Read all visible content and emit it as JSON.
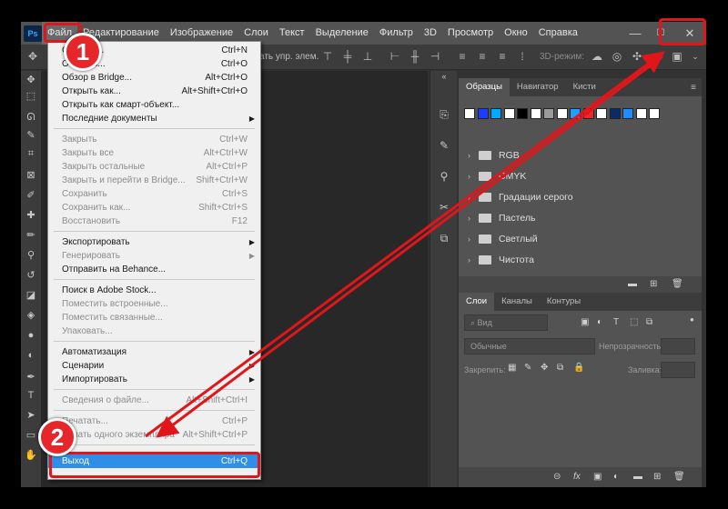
{
  "app": {
    "logo": "Ps"
  },
  "menubar": [
    "Файл",
    "Редактирование",
    "Изображение",
    "Слои",
    "Текст",
    "Выделение",
    "Фильтр",
    "3D",
    "Просмотр",
    "Окно",
    "Справка"
  ],
  "window_controls": {
    "minimize": "—",
    "maximize": "☐",
    "close": "✕"
  },
  "options_bar": {
    "text": "ать упр. элем.",
    "mode3d": "3D-режим:"
  },
  "file_menu": {
    "items": [
      {
        "label": "Создать...",
        "shortcut": "Ctrl+N"
      },
      {
        "label": "Открыть...",
        "shortcut": "Ctrl+O"
      },
      {
        "label": "Обзор в Bridge...",
        "shortcut": "Alt+Ctrl+O"
      },
      {
        "label": "Открыть как...",
        "shortcut": "Alt+Shift+Ctrl+O"
      },
      {
        "label": "Открыть как смарт-объект...",
        "shortcut": ""
      },
      {
        "label": "Последние документы",
        "shortcut": "",
        "submenu": true
      },
      {
        "label": "Закрыть",
        "shortcut": "Ctrl+W",
        "disabled": true
      },
      {
        "label": "Закрыть все",
        "shortcut": "Alt+Ctrl+W",
        "disabled": true
      },
      {
        "label": "Закрыть остальные",
        "shortcut": "Alt+Ctrl+P",
        "disabled": true
      },
      {
        "label": "Закрыть и перейти в Bridge...",
        "shortcut": "Shift+Ctrl+W",
        "disabled": true
      },
      {
        "label": "Сохранить",
        "shortcut": "Ctrl+S",
        "disabled": true
      },
      {
        "label": "Сохранить как...",
        "shortcut": "Shift+Ctrl+S",
        "disabled": true
      },
      {
        "label": "Восстановить",
        "shortcut": "F12",
        "disabled": true
      },
      {
        "label": "Экспортировать",
        "shortcut": "",
        "submenu": true
      },
      {
        "label": "Генерировать",
        "shortcut": "",
        "submenu": true,
        "disabled": true
      },
      {
        "label": "Отправить на Behance...",
        "shortcut": ""
      },
      {
        "label": "Поиск в Adobe Stock...",
        "shortcut": ""
      },
      {
        "label": "Поместить встроенные...",
        "shortcut": "",
        "disabled": true
      },
      {
        "label": "Поместить связанные...",
        "shortcut": "",
        "disabled": true
      },
      {
        "label": "Упаковать...",
        "shortcut": "",
        "disabled": true
      },
      {
        "label": "Автоматизация",
        "shortcut": "",
        "submenu": true
      },
      {
        "label": "Сценарии",
        "shortcut": "",
        "submenu": true
      },
      {
        "label": "Импортировать",
        "shortcut": "",
        "submenu": true
      },
      {
        "label": "Сведения о файле...",
        "shortcut": "Alt+Shift+Ctrl+I",
        "disabled": true
      },
      {
        "label": "Печатать...",
        "shortcut": "Ctrl+P",
        "disabled": true
      },
      {
        "label": "Печать одного экземпляра",
        "shortcut": "Alt+Shift+Ctrl+P",
        "disabled": true
      },
      {
        "label": "Выход",
        "shortcut": "Ctrl+Q",
        "highlighted": true
      }
    ]
  },
  "swatches_panel": {
    "tabs": [
      "Образцы",
      "Навигатор",
      "Кисти"
    ],
    "colors": [
      "#ffffff",
      "#1e3cff",
      "#00a8ff",
      "#ffffff",
      "#000000",
      "#ffffff",
      "#9a9a9a",
      "#ffffff",
      "#1aa0ff",
      "#e52b2b",
      "#ffffff",
      "#0a2a6a",
      "#1e8cff",
      "#ffffff",
      "#ffffff"
    ],
    "groups": [
      "RGB",
      "CMYK",
      "Градации серого",
      "Пастель",
      "Светлый",
      "Чистота"
    ]
  },
  "layers_panel": {
    "tabs": [
      "Слои",
      "Каналы",
      "Контуры"
    ],
    "kind_placeholder": "Вид",
    "blend_mode": "Обычные",
    "opacity_label": "Непрозрачность:",
    "lock_label": "Закрепить:",
    "fill_label": "Заливка:"
  },
  "annotations": {
    "step1": "1",
    "step2": "2"
  }
}
